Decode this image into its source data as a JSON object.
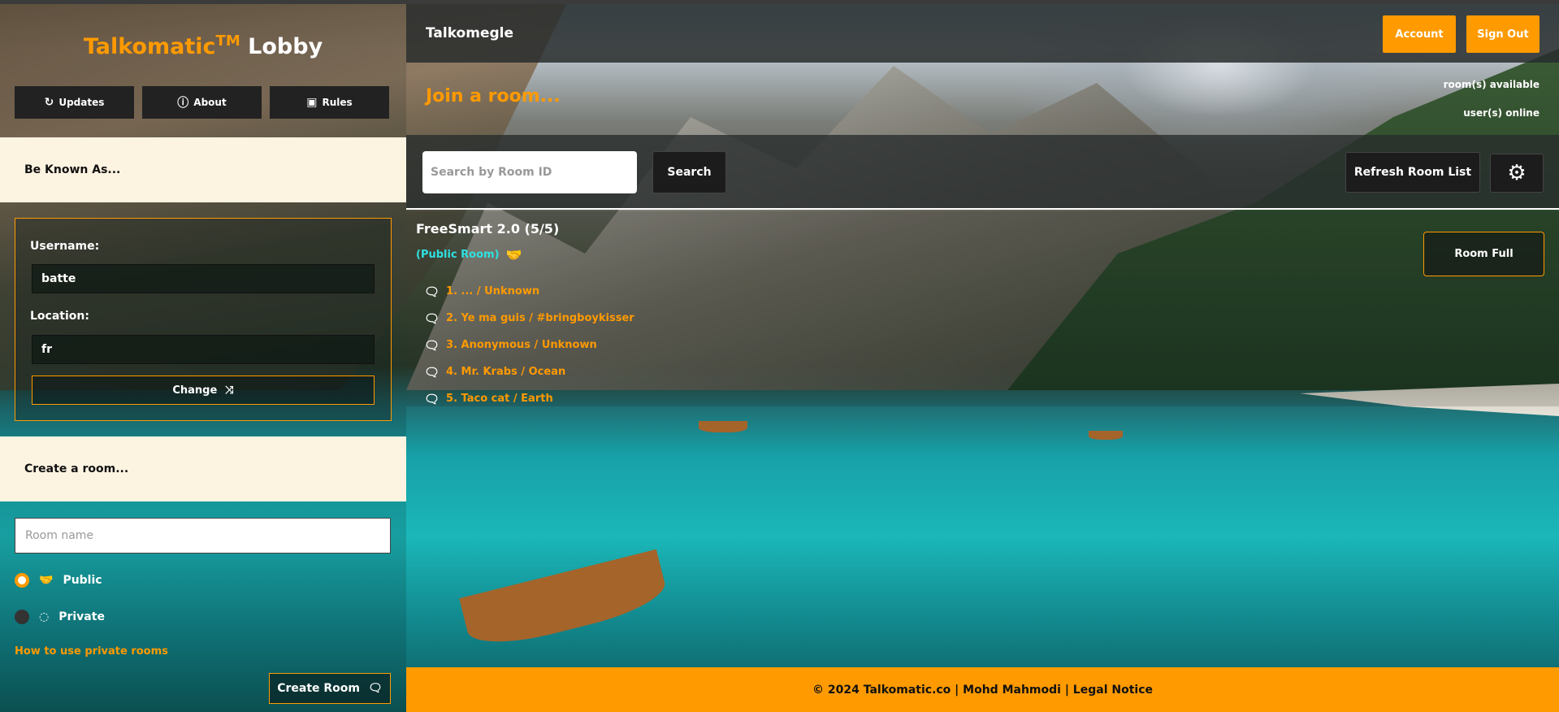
{
  "logo": {
    "brand": "Talkomatic",
    "tm": "TM",
    "lobby": "Lobby"
  },
  "sidebar": {
    "buttons": [
      {
        "icon": "refresh-icon",
        "label": "Updates"
      },
      {
        "icon": "info-icon",
        "label": "About"
      },
      {
        "icon": "clipboard-icon",
        "label": "Rules"
      }
    ],
    "known_heading": "Be Known As...",
    "username_label": "Username:",
    "username_value": "batte",
    "location_label": "Location:",
    "location_value": "fr",
    "change_label": "Change",
    "create_heading": "Create a room...",
    "room_name_placeholder": "Room name",
    "public_label": "Public",
    "private_label": "Private",
    "how_link": "How to use private rooms",
    "create_button": "Create Room"
  },
  "header": {
    "app_name": "Talkomegle",
    "account_label": "Account",
    "signout_label": "Sign Out"
  },
  "main": {
    "join_heading": "Join a room...",
    "rooms_available": "room(s) available",
    "users_online": "user(s) online",
    "search_placeholder": "Search by Room ID",
    "search_button": "Search",
    "refresh_button": "Refresh Room List",
    "settings_icon": "gear-icon"
  },
  "room": {
    "title": "FreeSmart 2.0 (5/5)",
    "type": "(Public Room)",
    "status_button": "Room Full",
    "users": [
      "1. ... / Unknown",
      "2. Ye ma guis / #bringboykisser",
      "3. Anonymous / Unknown",
      "4. Mr. Krabs / Ocean",
      "5. Taco cat / Earth"
    ]
  },
  "footer": {
    "text": "© 2024 Talkomatic.co | Mohd Mahmodi | Legal Notice"
  },
  "colors": {
    "accent": "#ff9a00",
    "cream": "#fdf3e1",
    "public_room": "#2fe0e0"
  }
}
